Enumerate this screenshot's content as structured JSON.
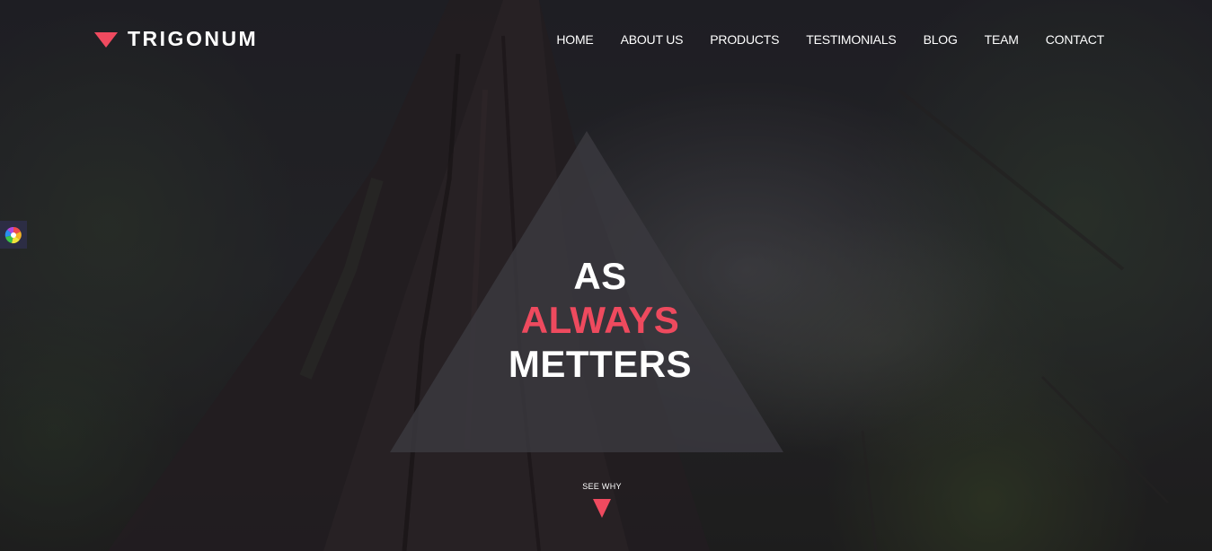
{
  "brand": {
    "name": "TRIGONUM",
    "mark_icon": "down-triangle-logo-icon",
    "accent_color": "#ef4a5f"
  },
  "nav": {
    "items": [
      {
        "label": "HOME"
      },
      {
        "label": "ABOUT US"
      },
      {
        "label": "PRODUCTS"
      },
      {
        "label": "TESTIMONIALS"
      },
      {
        "label": "BLOG"
      },
      {
        "label": "TEAM"
      },
      {
        "label": "CONTACT"
      }
    ]
  },
  "side_widget": {
    "icon": "color-wheel-icon"
  },
  "hero": {
    "line1": "AS",
    "line2": "ALWAYS",
    "line3": "METTERS",
    "background_image": "forest-tree-trunk-icon"
  },
  "cta": {
    "label": "SEE WHY",
    "icon": "down-arrow-triangle-icon"
  }
}
